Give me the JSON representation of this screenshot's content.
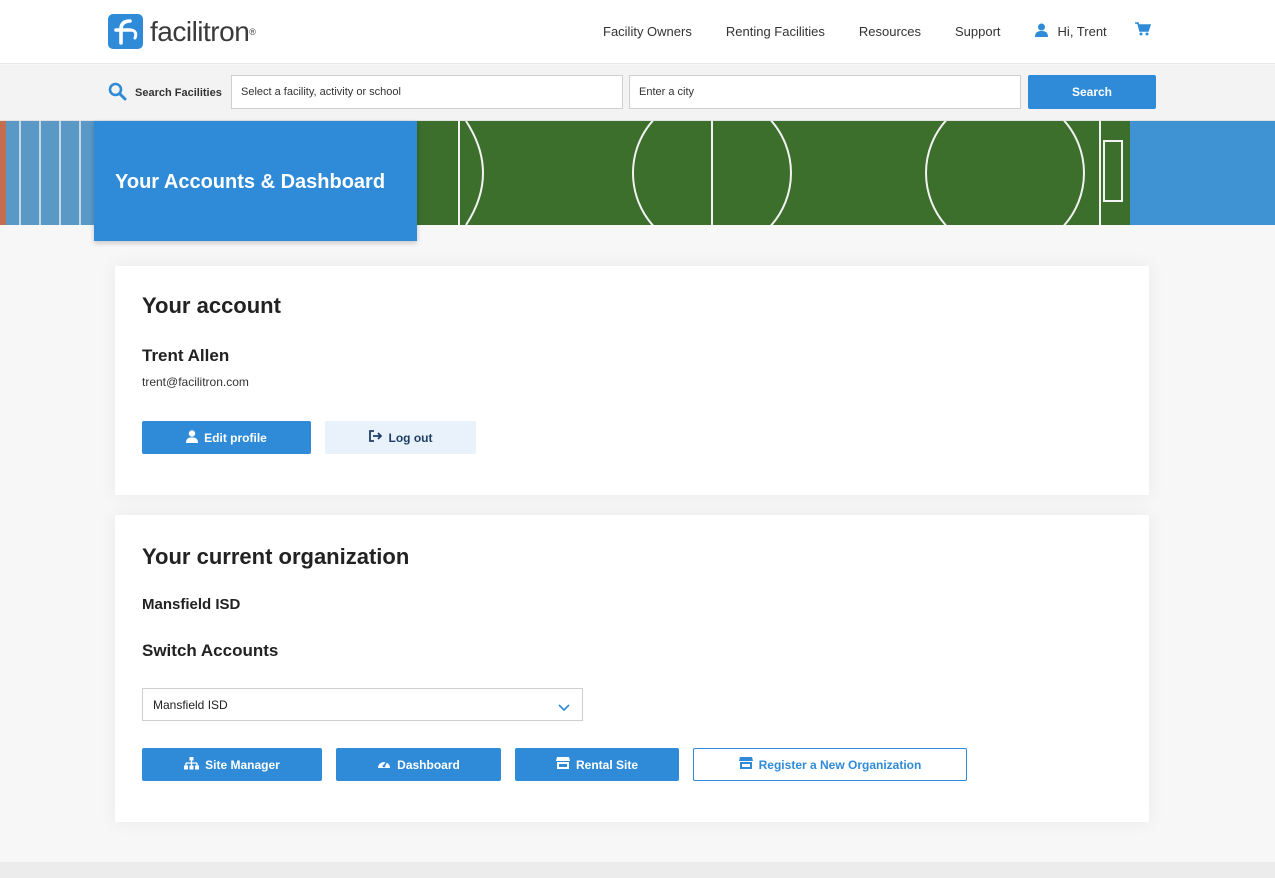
{
  "brand": {
    "name": "facilitron",
    "reg_mark": "®",
    "color": "#2f8bd8"
  },
  "nav": {
    "links": [
      "Facility Owners",
      "Renting Facilities",
      "Resources",
      "Support"
    ],
    "user_greeting": "Hi, Trent",
    "user_icon": "user-icon",
    "cart_icon": "cart-icon"
  },
  "search": {
    "label": "Search Facilities",
    "facility_placeholder": "Select a facility, activity or school",
    "city_placeholder": "Enter a city",
    "button_label": "Search"
  },
  "hero": {
    "title": "Your Accounts & Dashboard"
  },
  "account": {
    "title": "Your account",
    "name": "Trent Allen",
    "email": "trent@facilitron.com",
    "edit_label": "Edit profile",
    "logout_label": "Log out"
  },
  "organization": {
    "title": "Your current organization",
    "name": "Mansfield ISD",
    "switch_title": "Switch Accounts",
    "selected_account": "Mansfield ISD",
    "buttons": {
      "site_manager": "Site Manager",
      "dashboard": "Dashboard",
      "rental_site": "Rental Site",
      "register": "Register a New Organization"
    }
  }
}
